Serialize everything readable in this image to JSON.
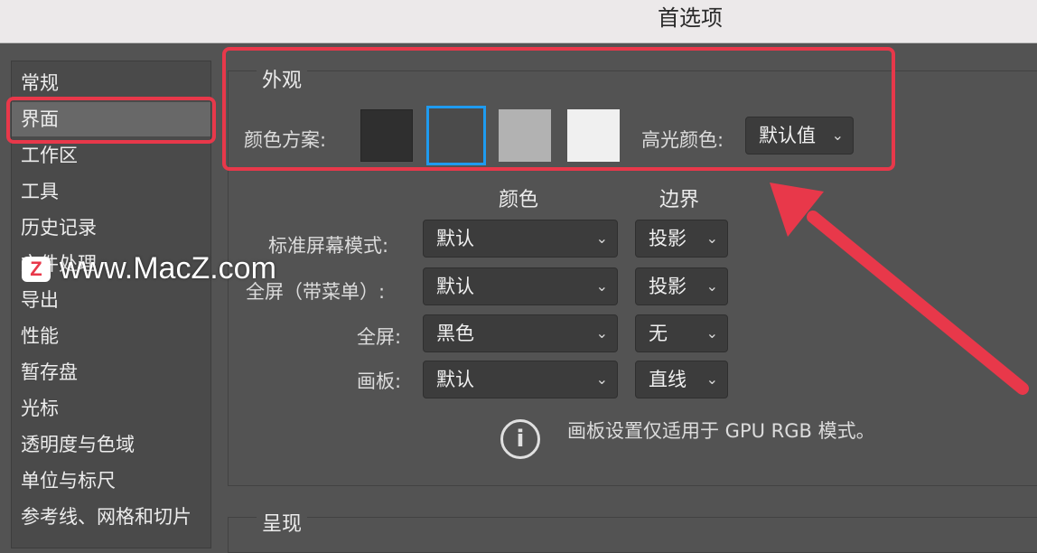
{
  "window": {
    "title": "首选项"
  },
  "sidebar": {
    "items": [
      {
        "label": "常规"
      },
      {
        "label": "界面",
        "selected": true
      },
      {
        "label": "工作区"
      },
      {
        "label": "工具"
      },
      {
        "label": "历史记录"
      },
      {
        "label": "文件处理"
      },
      {
        "label": "导出"
      },
      {
        "label": "性能"
      },
      {
        "label": "暂存盘"
      },
      {
        "label": "光标"
      },
      {
        "label": "透明度与色域"
      },
      {
        "label": "单位与标尺"
      },
      {
        "label": "参考线、网格和切片"
      }
    ]
  },
  "appearance": {
    "title": "外观",
    "color_scheme_label": "颜色方案:",
    "swatches": [
      {
        "name": "darkest",
        "color": "#2f2f2f"
      },
      {
        "name": "dark",
        "color": "#4b4b4b",
        "selected": true
      },
      {
        "name": "medium-light",
        "color": "#b2b2b2"
      },
      {
        "name": "lightest",
        "color": "#f0f0f0"
      }
    ],
    "highlight_label": "高光颜色:",
    "highlight_value": "默认值"
  },
  "modes": {
    "color_header": "颜色",
    "border_header": "边界",
    "rows": [
      {
        "label": "标准屏幕模式:",
        "color": "默认",
        "border": "投影"
      },
      {
        "label": "全屏（带菜单）:",
        "color": "默认",
        "border": "投影"
      },
      {
        "label": "全屏:",
        "color": "黑色",
        "border": "无"
      },
      {
        "label": "画板:",
        "color": "默认",
        "border": "直线"
      }
    ],
    "info_text": "画板设置仅适用于 GPU RGB 模式。"
  },
  "presentation": {
    "title": "呈现"
  },
  "watermark": {
    "text": "www.MacZ.com",
    "logo": "Z"
  },
  "colors": {
    "accent": "#e8384a",
    "selection_blue": "#1e9bf0",
    "panel_bg": "#535353"
  }
}
